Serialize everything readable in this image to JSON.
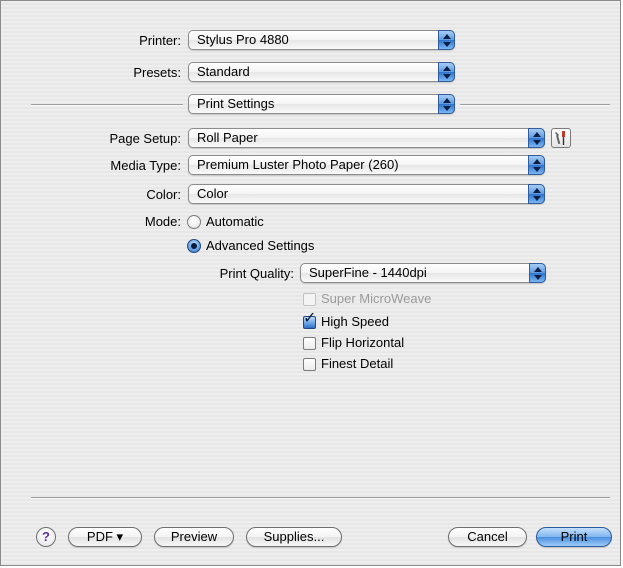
{
  "printer": {
    "label": "Printer:",
    "value": "Stylus Pro 4880"
  },
  "presets": {
    "label": "Presets:",
    "value": "Standard"
  },
  "panel": {
    "value": "Print Settings"
  },
  "page_setup": {
    "label": "Page Setup:",
    "value": "Roll Paper"
  },
  "media_type": {
    "label": "Media Type:",
    "value": "Premium Luster Photo Paper (260)"
  },
  "color": {
    "label": "Color:",
    "value": "Color"
  },
  "mode": {
    "label": "Mode:",
    "options": [
      {
        "label": "Automatic",
        "selected": false
      },
      {
        "label": "Advanced Settings",
        "selected": true
      }
    ]
  },
  "print_quality": {
    "label": "Print Quality:",
    "value": "SuperFine - 1440dpi"
  },
  "checkboxes": [
    {
      "label": "Super MicroWeave",
      "checked": false,
      "enabled": false
    },
    {
      "label": "High Speed",
      "checked": true,
      "enabled": true
    },
    {
      "label": "Flip Horizontal",
      "checked": false,
      "enabled": true
    },
    {
      "label": "Finest Detail",
      "checked": false,
      "enabled": true
    }
  ],
  "buttons": {
    "help": "?",
    "pdf": "PDF ▾",
    "preview": "Preview",
    "supplies": "Supplies...",
    "cancel": "Cancel",
    "print": "Print"
  },
  "icons": {
    "page_setup_tool": "wrench-screwdriver-icon"
  }
}
